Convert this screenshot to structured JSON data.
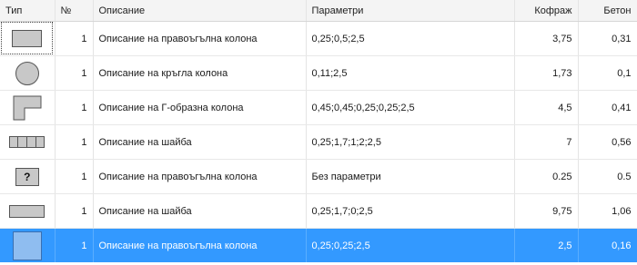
{
  "columns": {
    "type": "Тип",
    "no": "№",
    "description": "Описание",
    "parameters": "Параметри",
    "formwork": "Кофраж",
    "concrete": "Бетон"
  },
  "rows": [
    {
      "icon": "rectangular-column-icon",
      "no": "1",
      "description": "Описание на правоъгълна колона",
      "parameters": "0,25;0,5;2,5",
      "formwork": "3,75",
      "concrete": "0,31"
    },
    {
      "icon": "round-column-icon",
      "no": "1",
      "description": "Описание на кръгла колона",
      "parameters": "0,11;2,5",
      "formwork": "1,73",
      "concrete": "0,1"
    },
    {
      "icon": "l-shaped-column-icon",
      "no": "1",
      "description": "Описание на Г-образна колона",
      "parameters": "0,45;0,45;0,25;0,25;2,5",
      "formwork": "4,5",
      "concrete": "0,41"
    },
    {
      "icon": "wall-segment-icon",
      "no": "1",
      "description": "Описание на шайба",
      "parameters": "0,25;1,7;1;2;2,5",
      "formwork": "7",
      "concrete": "0,56"
    },
    {
      "icon": "question-mark-icon",
      "no": "1",
      "description": "Описание на правоъгълна колона",
      "parameters": "Без параметри",
      "formwork": "0.25",
      "concrete": "0.5"
    },
    {
      "icon": "wall-icon",
      "no": "1",
      "description": "Описание на шайба",
      "parameters": "0,25;1,7;0;2,5",
      "formwork": "9,75",
      "concrete": "1,06"
    },
    {
      "icon": "rectangular-column-selected-icon",
      "no": "1",
      "description": "Описание на правоъгълна колона",
      "parameters": "0,25;0,25;2,5",
      "formwork": "2,5",
      "concrete": "0,16",
      "selected": true
    }
  ],
  "colors": {
    "selection": "#3399ff",
    "header_bg": "#f4f4f4",
    "icon_fill": "#c8c8c8"
  }
}
